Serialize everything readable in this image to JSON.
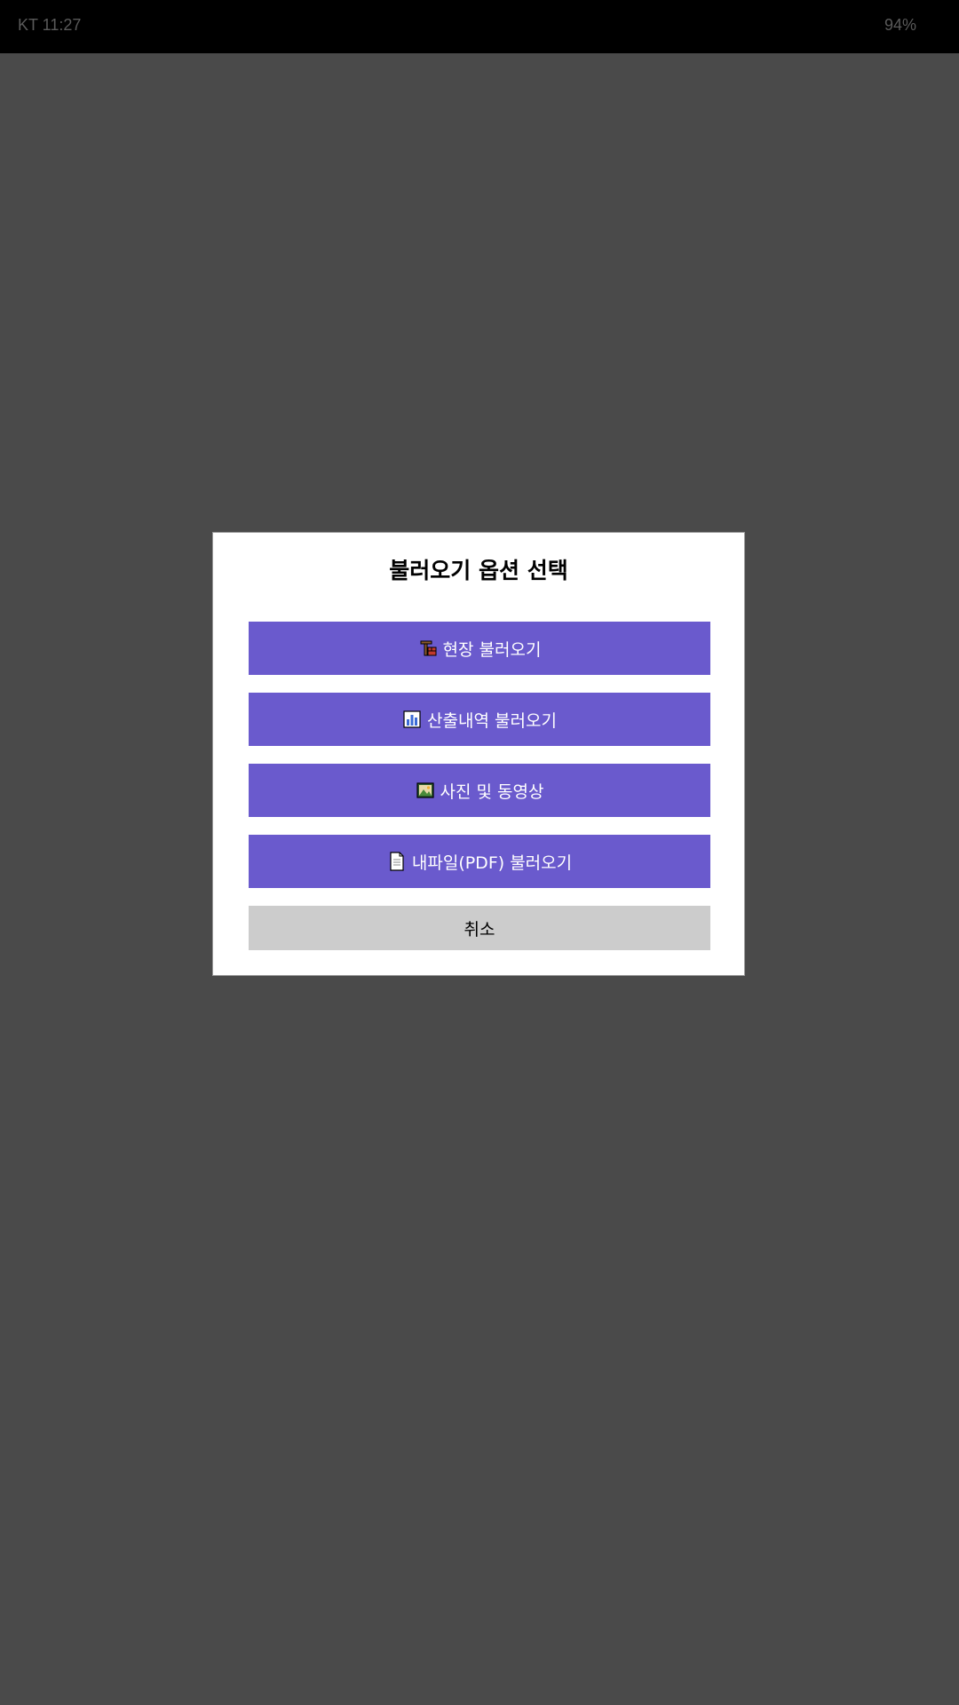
{
  "status_bar": {
    "left": "KT 11:27",
    "battery": "94%"
  },
  "dialog": {
    "title": "불러오기 옵션 선택",
    "options": [
      {
        "icon": "construction-icon",
        "label": "현장 불러오기"
      },
      {
        "icon": "chart-icon",
        "label": "산출내역 불러오기"
      },
      {
        "icon": "picture-icon",
        "label": "사진 및 동영상"
      },
      {
        "icon": "document-icon",
        "label": "내파일(PDF) 불러오기"
      }
    ],
    "cancel_label": "취소"
  },
  "colors": {
    "option_button": "#6a5acd",
    "cancel_button": "#cccccc",
    "overlay": "#4a4a4a",
    "status_bar": "#000000"
  }
}
